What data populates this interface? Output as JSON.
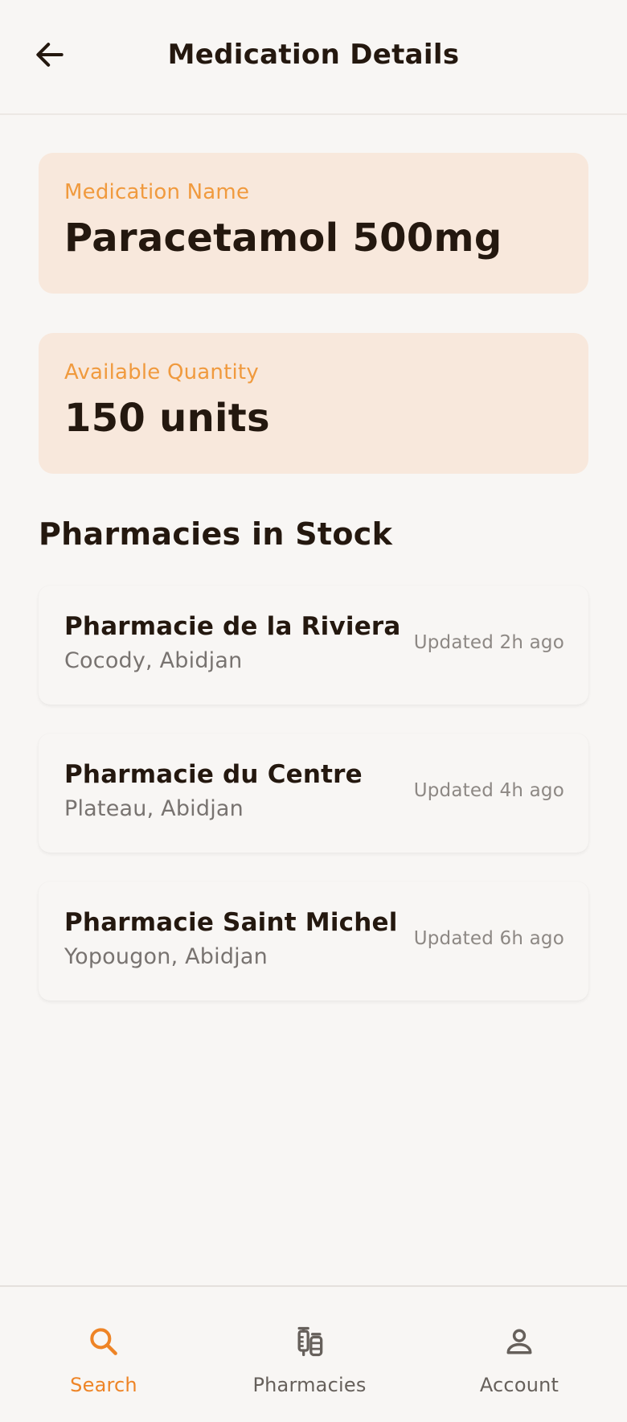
{
  "header": {
    "title": "Medication Details"
  },
  "medication": {
    "name_label": "Medication Name",
    "name": "Paracetamol 500mg",
    "quantity_label": "Available Quantity",
    "quantity": "150 units"
  },
  "pharmacies_section": {
    "title": "Pharmacies in Stock",
    "items": [
      {
        "name": "Pharmacie de la Riviera",
        "location": "Cocody, Abidjan",
        "updated": "Updated 2h ago"
      },
      {
        "name": "Pharmacie du Centre",
        "location": "Plateau, Abidjan",
        "updated": "Updated 4h ago"
      },
      {
        "name": "Pharmacie Saint Michel",
        "location": "Yopougon, Abidjan",
        "updated": "Updated 6h ago"
      }
    ]
  },
  "bottom_nav": {
    "items": [
      {
        "label": "Search",
        "icon": "search-icon",
        "active": true
      },
      {
        "label": "Pharmacies",
        "icon": "medicine-icon",
        "active": false
      },
      {
        "label": "Account",
        "icon": "person-icon",
        "active": false
      }
    ]
  },
  "colors": {
    "accent": "#ee8426",
    "card_bg": "#f8e8dc",
    "label_orange": "#f09a3e",
    "text_dark": "#24180f",
    "text_muted": "#787370",
    "background": "#f8f6f4"
  }
}
